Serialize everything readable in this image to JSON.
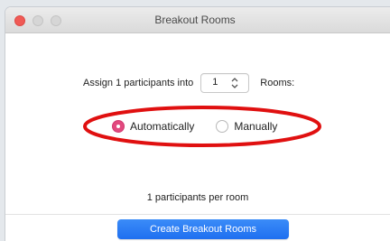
{
  "window": {
    "title": "Breakout Rooms"
  },
  "assign": {
    "prefix": "Assign 1 participants into",
    "room_count": "1",
    "suffix": "Rooms:"
  },
  "mode": {
    "options": [
      {
        "label": "Automatically",
        "selected": true
      },
      {
        "label": "Manually",
        "selected": false
      }
    ]
  },
  "summary": {
    "per_room": "1 participants per room"
  },
  "actions": {
    "create_label": "Create Breakout Rooms"
  },
  "colors": {
    "accent_radio": "#e2497f",
    "primary_button": "#2d7ff5",
    "annotation_ellipse": "#e01010"
  }
}
